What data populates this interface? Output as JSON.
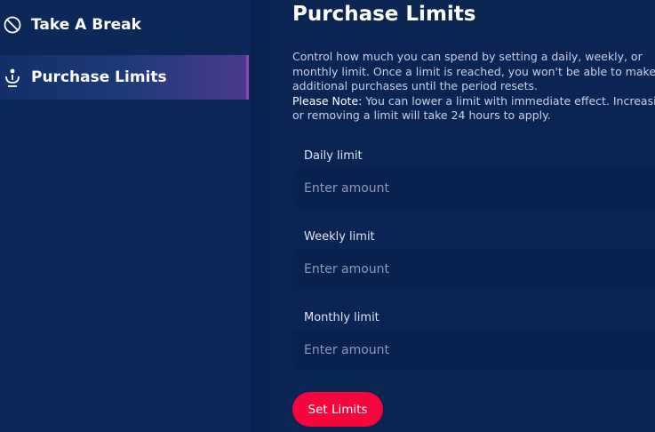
{
  "sidebar": {
    "items": [
      {
        "label": "Take A Break",
        "icon": "block-icon"
      },
      {
        "label": "Purchase Limits",
        "icon": "person-icon",
        "active": true
      }
    ]
  },
  "main": {
    "title": "Purchase Limits",
    "description": {
      "line1": "Control how much you can spend by setting a daily, weekly, or",
      "line2": "monthly limit. Once a limit is reached, you won't be able to make",
      "line3": "additional purchases until the period resets.",
      "note_label": "Please Note:",
      "note_line1": " You can lower a limit with immediate effect. Increasing",
      "note_line2": "or removing a limit will take 24 hours to apply."
    },
    "fields": [
      {
        "label": "Daily limit",
        "placeholder": "Enter amount",
        "value": ""
      },
      {
        "label": "Weekly limit",
        "placeholder": "Enter amount",
        "value": ""
      },
      {
        "label": "Monthly limit",
        "placeholder": "Enter amount",
        "value": ""
      }
    ],
    "submit_label": "Set Limits"
  },
  "colors": {
    "background": "#0b2553",
    "input_bg": "#08214d",
    "accent_button": "#f5073e",
    "active_border": "#8e47b9"
  }
}
